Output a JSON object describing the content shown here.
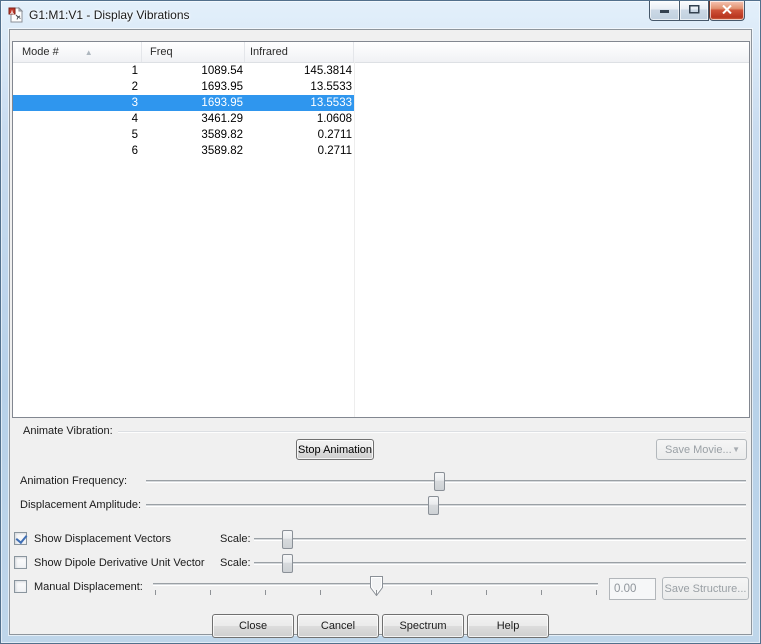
{
  "window": {
    "title": "G1:M1:V1 - Display Vibrations",
    "app_icon": "molecule-document-icon",
    "controls": {
      "minimize_icon": "minimize-icon",
      "maximize_icon": "maximize-icon",
      "close_icon": "close-icon"
    }
  },
  "table": {
    "columns": [
      {
        "label": "Mode #",
        "sort": "ascending",
        "sort_icon": "sort-ascending-icon"
      },
      {
        "label": "Freq"
      },
      {
        "label": "Infrared"
      }
    ],
    "rows": [
      {
        "mode": "1",
        "freq": "1089.54",
        "infrared": "145.3814",
        "selected": false
      },
      {
        "mode": "2",
        "freq": "1693.95",
        "infrared": "13.5533",
        "selected": false
      },
      {
        "mode": "3",
        "freq": "1693.95",
        "infrared": "13.5533",
        "selected": true
      },
      {
        "mode": "4",
        "freq": "3461.29",
        "infrared": "1.0608",
        "selected": false
      },
      {
        "mode": "5",
        "freq": "3589.82",
        "infrared": "0.2711",
        "selected": false
      },
      {
        "mode": "6",
        "freq": "3589.82",
        "infrared": "0.2711",
        "selected": false
      }
    ]
  },
  "animate": {
    "section_label": "Animate Vibration:",
    "stop_button": "Stop Animation",
    "save_movie_button": "Save Movie...",
    "save_movie_enabled": false,
    "dropdown_icon": "dropdown-arrow-icon",
    "frequency_label": "Animation Frequency:",
    "amplitude_label": "Displacement Amplitude:"
  },
  "sliders": {
    "animation_frequency_percent": 49,
    "displacement_amplitude_percent": 48,
    "vector_scale_percent": 7,
    "dipole_scale_percent": 7,
    "manual_displacement_percent": 50
  },
  "options": {
    "show_displacement_vectors": {
      "label": "Show Displacement Vectors",
      "checked": true,
      "scale_label": "Scale:"
    },
    "show_dipole_derivative": {
      "label": "Show Dipole Derivative Unit Vector",
      "checked": false,
      "scale_label": "Scale:"
    },
    "manual_displacement": {
      "label": "Manual Displacement:",
      "checked": false,
      "value": "0.00",
      "value_enabled": false,
      "save_structure_button": "Save Structure...",
      "save_structure_enabled": false
    }
  },
  "footer": {
    "buttons": [
      {
        "label": "Close"
      },
      {
        "label": "Cancel"
      },
      {
        "label": "Spectrum"
      },
      {
        "label": "Help"
      }
    ]
  },
  "colors": {
    "selection_blue": "#2f96ee",
    "titlebar_blue": "#bdd6ec",
    "close_button_red": "#cc4431",
    "checkmark_blue": "#3f6fb5"
  }
}
